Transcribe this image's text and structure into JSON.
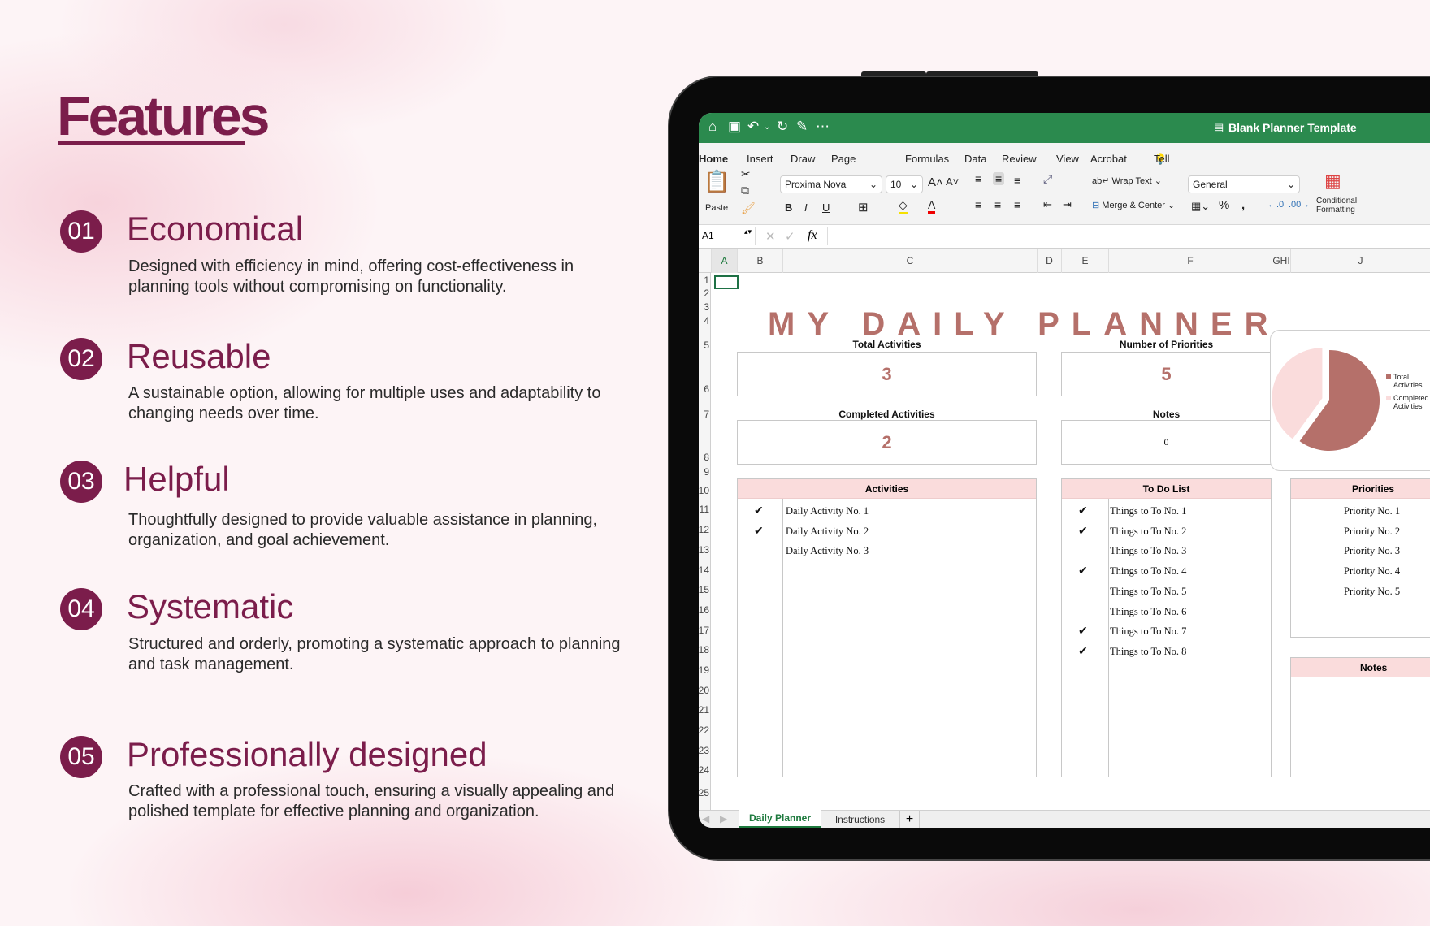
{
  "features": {
    "title": "Features",
    "items": [
      {
        "num": "01",
        "title": "Economical",
        "desc": "Designed with efficiency in mind, offering cost-effectiveness in planning tools without compromising on functionality."
      },
      {
        "num": "02",
        "title": "Reusable",
        "desc": "A sustainable option, allowing for multiple uses and adaptability to changing needs over time."
      },
      {
        "num": "03",
        "title": "Helpful",
        "desc": "Thoughtfully designed to provide valuable assistance in planning, organization, and goal achievement."
      },
      {
        "num": "04",
        "title": "Systematic",
        "desc": "Structured and orderly, promoting a systematic approach to planning and task management."
      },
      {
        "num": "05",
        "title": "Professionally designed",
        "desc": "Crafted with a professional touch, ensuring a visually appealing and polished template for effective planning and organization."
      }
    ]
  },
  "excel": {
    "doc_title": "Blank Planner Template",
    "menu": [
      "Home",
      "Insert",
      "Draw",
      "Page Layout",
      "Formulas",
      "Data",
      "Review",
      "View",
      "Acrobat",
      "Tell me"
    ],
    "ribbon": {
      "paste": "Paste",
      "font": "Proxima Nova",
      "size": "10",
      "wrap": "Wrap Text",
      "merge": "Merge & Center",
      "format": "General",
      "cond": "Conditional Formatting",
      "bold": "B",
      "italic": "I",
      "underline": "U",
      "fx": "fx"
    },
    "name_box": "A1",
    "columns": [
      "A",
      "B",
      "C",
      "D",
      "E",
      "F",
      "GHI",
      "J"
    ],
    "rows": [
      "1",
      "2",
      "3",
      "4",
      "5",
      "6",
      "7",
      "8",
      "9",
      "10",
      "11",
      "12",
      "13",
      "14",
      "15",
      "16",
      "17",
      "18",
      "19",
      "20",
      "21",
      "22",
      "23",
      "24",
      "25"
    ],
    "sheet_tabs": [
      "Daily Planner",
      "Instructions"
    ],
    "accent": "#2b8a4e"
  },
  "planner": {
    "title": "MY DAILY PLANNER",
    "total_label": "Total Activities",
    "total": "3",
    "priorities_label": "Number of Priorities",
    "priorities": "5",
    "completed_label": "Completed Activities",
    "completed": "2",
    "notes_label": "Notes",
    "notes": "0",
    "activities": {
      "header": "Activities",
      "items": [
        {
          "text": "Daily Activity No. 1",
          "done": true
        },
        {
          "text": "Daily Activity No. 2",
          "done": true
        },
        {
          "text": "Daily Activity No. 3",
          "done": false
        }
      ]
    },
    "todo": {
      "header": "To Do List",
      "items": [
        {
          "text": "Things to To No. 1",
          "done": true
        },
        {
          "text": "Things to To No. 2",
          "done": true
        },
        {
          "text": "Things to To No. 3",
          "done": false
        },
        {
          "text": "Things to To No. 4",
          "done": true
        },
        {
          "text": "Things to To No. 5",
          "done": false
        },
        {
          "text": "Things to To No. 6",
          "done": false
        },
        {
          "text": "Things to To No. 7",
          "done": true
        },
        {
          "text": "Things to To No. 8",
          "done": true
        }
      ]
    },
    "priorities_list": {
      "header": "Priorities",
      "items": [
        "Priority No. 1",
        "Priority No. 2",
        "Priority No. 3",
        "Priority No. 4",
        "Priority No. 5"
      ]
    },
    "notes_box": {
      "header": "Notes"
    },
    "check_glyph": "✔"
  },
  "chart_data": {
    "type": "pie",
    "categories": [
      "Total Activities",
      "Completed Activities"
    ],
    "values": [
      3,
      2
    ],
    "colors": [
      "#b5706a",
      "#fadcdc"
    ],
    "legend": "right"
  }
}
